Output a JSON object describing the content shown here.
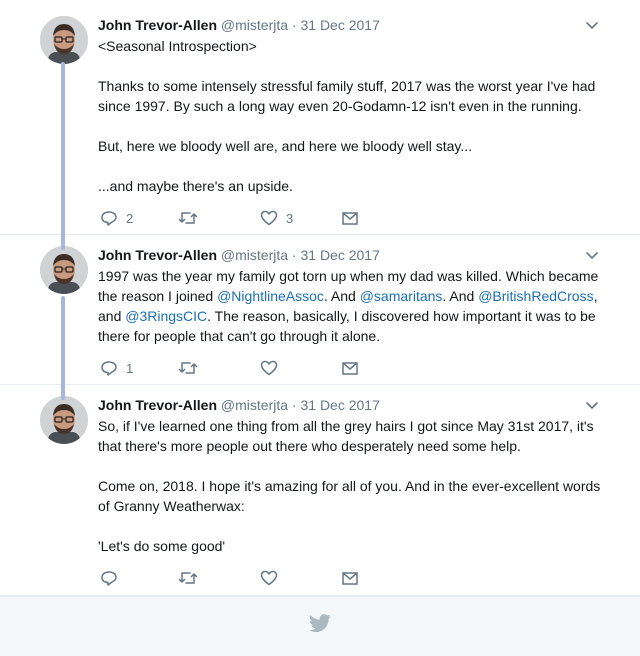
{
  "author": {
    "name": "John Trevor-Allen",
    "handle": "@misterjta",
    "separator": "·"
  },
  "tweets": [
    {
      "date": "31 Dec 2017",
      "paragraphs": [
        "<Seasonal Introspection>",
        "Thanks to some intensely stressful family stuff, 2017 was the worst year I've had since 1997. By such a long way even 20-Godamn-12 isn't even in the running.",
        "But, here we bloody well are, and here we bloody well stay...",
        "...and maybe there's an upside."
      ],
      "reply_count": "2",
      "retweet_count": "",
      "like_count": "3"
    },
    {
      "date": "31 Dec 2017",
      "text_parts": {
        "p1": "1997 was the year my family got torn up when my dad was killed. Which became the reason I joined ",
        "m1": "@NightlineAssoc",
        "p2": ". And ",
        "m2": "@samaritans",
        "p3": ". And ",
        "m3": "@BritishRedCross",
        "p4": ", and ",
        "m4": "@3RingsCIC",
        "p5": ". The reason, basically, I discovered how important it was to be there for people that can't go through it alone."
      },
      "reply_count": "1",
      "retweet_count": "",
      "like_count": ""
    },
    {
      "date": "31 Dec 2017",
      "paragraphs": [
        "So, if I've learned one thing from all the grey hairs I got since May 31st 2017, it's that there's more people out there who desperately need some help.",
        "Come on, 2018. I hope it's amazing for all of you. And in the ever-excellent words of Granny Weatherwax:",
        "'Let's do some good'"
      ],
      "reply_count": "",
      "retweet_count": "",
      "like_count": ""
    }
  ],
  "icons": {
    "reply": "reply-icon",
    "retweet": "retweet-icon",
    "like": "heart-icon",
    "dm": "envelope-icon",
    "more": "chevron-down-icon",
    "brand": "twitter-bird-icon"
  },
  "colors": {
    "thread_line": "#a8b6de",
    "mention": "#1b6fb5",
    "muted": "#657786",
    "brand_bird": "#aab8c2"
  }
}
